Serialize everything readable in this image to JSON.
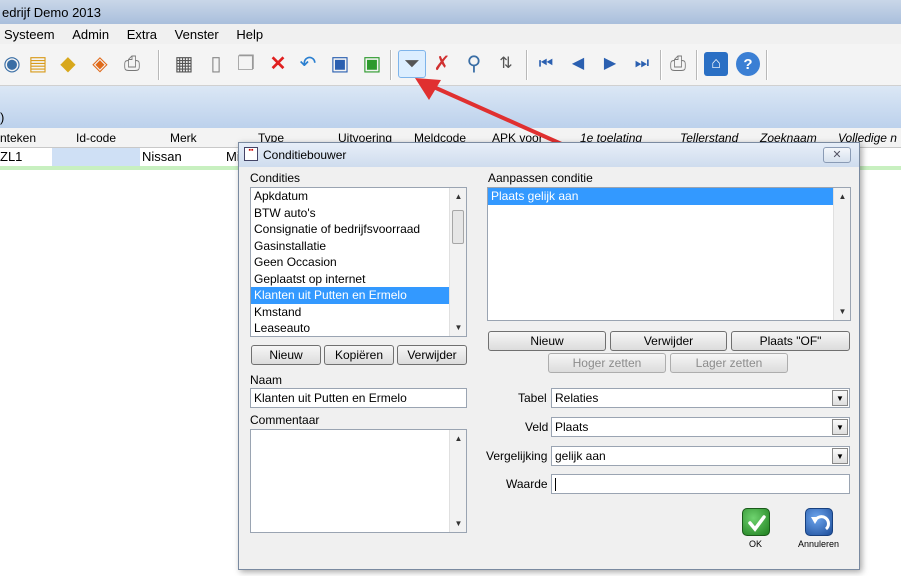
{
  "app": {
    "title": "edrijf Demo 2013",
    "menu": [
      "Systeem",
      "Admin",
      "Extra",
      "Venster",
      "Help"
    ],
    "bluebar_label": ")"
  },
  "grid": {
    "columns": [
      "nteken",
      "Id-code",
      "Merk",
      "Type",
      "Uitvoering",
      "Meldcode",
      "APK voor",
      "1e toelating",
      "Tellerstand",
      "Zoeknaam",
      "Volledige n"
    ],
    "row1": {
      "kenteken": "ZL1",
      "merk": "Nissan",
      "type": "Mi"
    }
  },
  "dialog": {
    "title": "Conditiebouwer",
    "close_label": "✕",
    "condities_label": "Condities",
    "condities": [
      "Apkdatum",
      "BTW auto's",
      "Consignatie of bedrijfsvoorraad",
      "Gasinstallatie",
      "Geen Occasion",
      "Geplaatst op internet",
      "Klanten uit Putten en Ermelo",
      "Kmstand",
      "Leaseauto"
    ],
    "selected_conditie": "Klanten uit Putten en Ermelo",
    "left_buttons": {
      "nieuw": "Nieuw",
      "kopieren": "Kopiëren",
      "verwijder": "Verwijder"
    },
    "naam_label": "Naam",
    "naam_value": "Klanten uit Putten en Ermelo",
    "commentaar_label": "Commentaar",
    "aanpassen_label": "Aanpassen conditie",
    "aanpassen_items": [
      "Plaats gelijk aan"
    ],
    "right_buttons": {
      "nieuw": "Nieuw",
      "verwijder": "Verwijder",
      "plaats_of": "Plaats \"OF\"",
      "hoger": "Hoger zetten",
      "lager": "Lager zetten"
    },
    "tabel_label": "Tabel",
    "tabel_value": "Relaties",
    "veld_label": "Veld",
    "veld_value": "Plaats",
    "vergelijking_label": "Vergelijking",
    "vergelijking_value": "gelijk aan",
    "waarde_label": "Waarde",
    "waarde_value": "",
    "ok_label": "OK",
    "annuleren_label": "Annuleren"
  },
  "colors": {
    "selection": "#3399ff",
    "arrow": "#e03030",
    "ok_green": "#2d9a2d",
    "cancel_blue": "#2a5fb0"
  }
}
